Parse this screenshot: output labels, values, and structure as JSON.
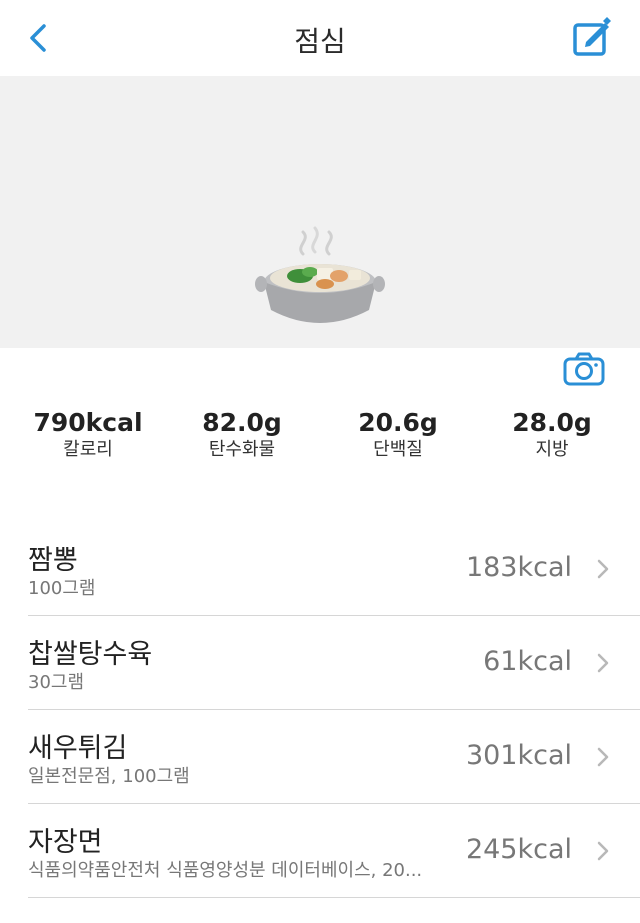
{
  "header": {
    "title": "점심",
    "back_icon": "chevron-left-icon",
    "edit_icon": "edit-icon"
  },
  "hero": {
    "image": "hotpot-dish-image",
    "camera_icon": "camera-icon"
  },
  "colors": {
    "accent": "#2a8fd6",
    "hero_bg": "#f1f1f1",
    "divider": "#d6d6d6"
  },
  "summary": [
    {
      "value": "790kcal",
      "label": "칼로리"
    },
    {
      "value": "82.0g",
      "label": "탄수화물"
    },
    {
      "value": "20.6g",
      "label": "단백질"
    },
    {
      "value": "28.0g",
      "label": "지방"
    }
  ],
  "foods": [
    {
      "name": "짬뽕",
      "detail": "100그램",
      "kcal": "183kcal"
    },
    {
      "name": "찹쌀탕수육",
      "detail": "30그램",
      "kcal": "61kcal"
    },
    {
      "name": "새우튀김",
      "detail": "일본전문점, 100그램",
      "kcal": "301kcal"
    },
    {
      "name": "자장면",
      "detail": "식품의약품안전처 식품영양성분 데이터베이스, 20...",
      "kcal": "245kcal"
    }
  ]
}
